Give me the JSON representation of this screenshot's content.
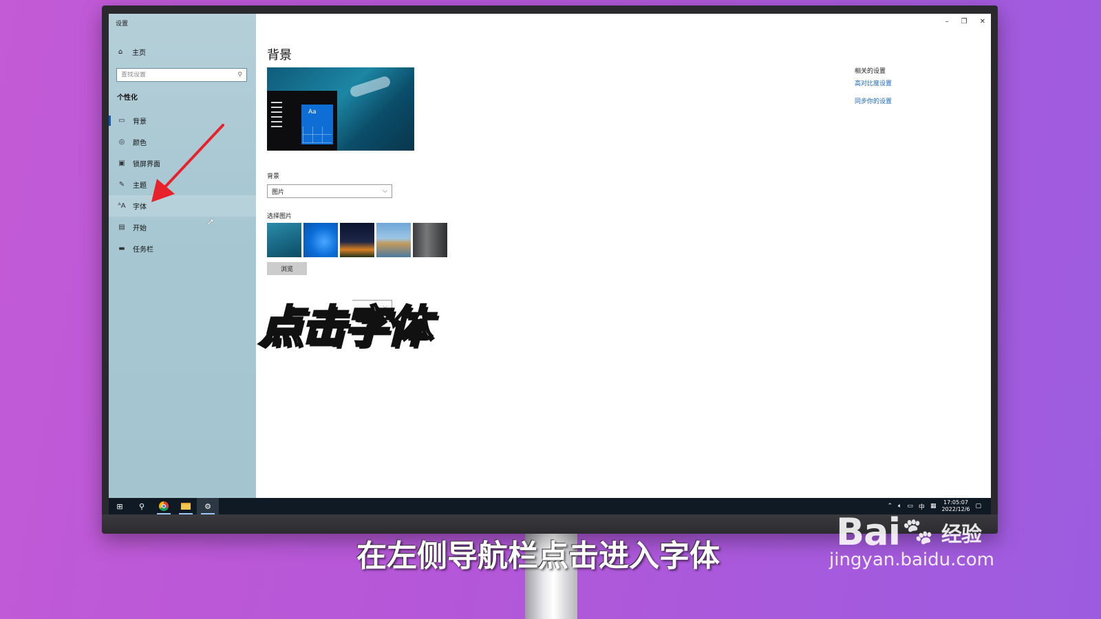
{
  "window": {
    "title": "设置",
    "controls": {
      "minimize": "–",
      "restore": "❐",
      "close": "✕"
    }
  },
  "sidebar": {
    "home": "主页",
    "search_placeholder": "查找设置",
    "section": "个性化",
    "items": [
      {
        "label": "背景",
        "icon": "picture-icon",
        "active": true
      },
      {
        "label": "颜色",
        "icon": "palette-icon"
      },
      {
        "label": "锁屏界面",
        "icon": "lock-screen-icon"
      },
      {
        "label": "主题",
        "icon": "theme-icon"
      },
      {
        "label": "字体",
        "icon": "font-icon",
        "hover": true
      },
      {
        "label": "开始",
        "icon": "start-icon"
      },
      {
        "label": "任务栏",
        "icon": "taskbar-icon"
      }
    ]
  },
  "main": {
    "title": "背景",
    "preview_tile_text": "Aa",
    "background_label": "背景",
    "background_value": "图片",
    "pick_label": "选择图片",
    "browse_label": "浏览"
  },
  "related": {
    "title": "相关的设置",
    "links": [
      "高对比度设置",
      "同步你的设置"
    ]
  },
  "taskbar": {
    "tray_ime": "中",
    "time": "17:05:07",
    "date": "2022/12/6"
  },
  "overlay_caption": "点击字体",
  "caption": "在左侧导航栏点击进入字体",
  "watermark": {
    "brand": "Bai",
    "brand_tail": "经验",
    "url": "jingyan.baidu.com"
  },
  "colors": {
    "accent": "#0a5fb4",
    "link": "#1a66c2",
    "arrow": "#e8222a",
    "taskbar": "#101a24"
  }
}
